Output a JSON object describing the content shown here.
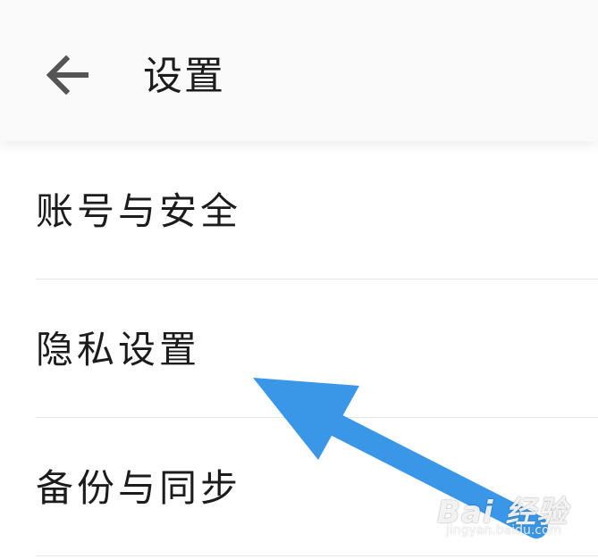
{
  "header": {
    "back_icon": "arrow-left-icon",
    "title": "设置"
  },
  "settings_list": {
    "items": [
      {
        "label": "账号与安全"
      },
      {
        "label": "隐私设置"
      },
      {
        "label": "备份与同步"
      }
    ]
  },
  "annotation": {
    "arrow_color": "#3a97e8",
    "points_to": "隐私设置"
  },
  "watermark": {
    "logo_text": "Bai  经验",
    "sub_text": "jingyan.baidu.com"
  },
  "colors": {
    "header_bg": "#fafafa",
    "page_bg": "#ffffff",
    "text": "#1c1c1c",
    "divider": "#e6e6e6",
    "back_icon": "#555555"
  }
}
